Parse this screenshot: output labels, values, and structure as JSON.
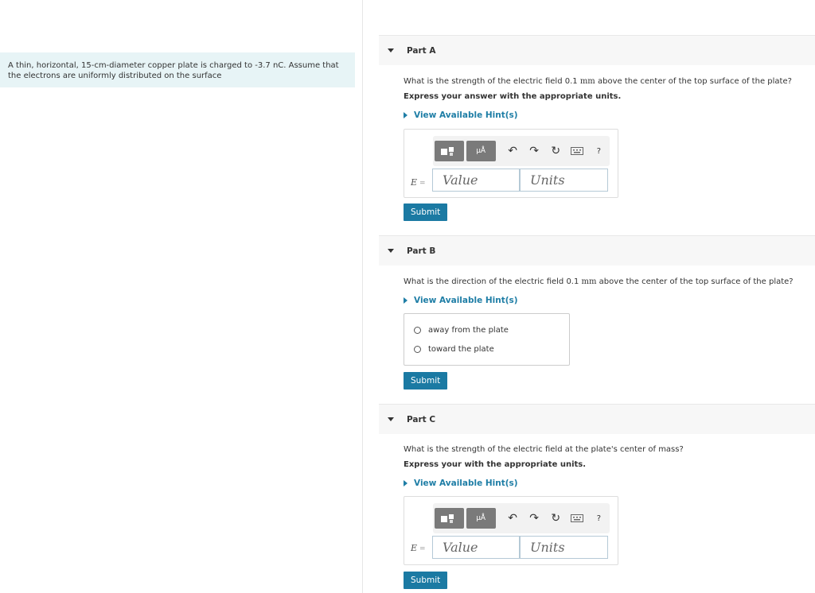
{
  "problem": {
    "text": "A thin, horizontal, 15-cm-diameter copper plate is charged to -3.7 nC. Assume that the electrons are uniformly distributed on the surface"
  },
  "parts": {
    "a": {
      "title": "Part A",
      "q_pre": "What is the strength of the electric field 0.1 ",
      "q_unit": "mm",
      "q_post": " above the center of the top surface of the plate?",
      "instruction": "Express your answer with the appropriate units.",
      "hint": "View Available Hint(s)",
      "var": "E",
      "eq": "=",
      "value_placeholder": "Value",
      "units_placeholder": "Units",
      "submit": "Submit"
    },
    "b": {
      "title": "Part B",
      "q_pre": "What is the direction of the electric field 0.1 ",
      "q_unit": "mm",
      "q_post": " above the center of the top surface of the plate?",
      "hint": "View Available Hint(s)",
      "choices": [
        "away from the plate",
        "toward the plate"
      ],
      "submit": "Submit"
    },
    "c": {
      "title": "Part C",
      "question": "What is the strength of the electric field at the plate's center of mass?",
      "instruction": "Express your with the appropriate units.",
      "hint": "View Available Hint(s)",
      "var": "E",
      "eq": "=",
      "value_placeholder": "Value",
      "units_placeholder": "Units",
      "submit": "Submit"
    }
  },
  "toolbar": {
    "templates_icon": "templates-icon",
    "units_icon": "units-icon",
    "units_glyph": "μÅ",
    "undo": "↶",
    "redo": "↷",
    "reset": "↻",
    "help": "?"
  }
}
